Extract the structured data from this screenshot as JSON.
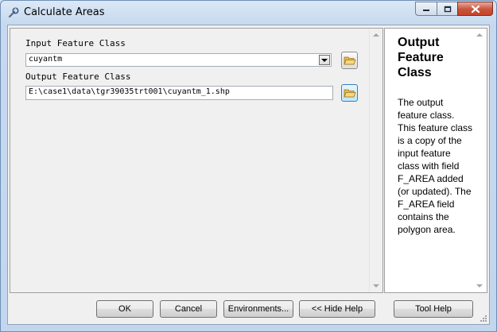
{
  "window": {
    "title": "Calculate Areas"
  },
  "form": {
    "input_label": "Input Feature Class",
    "input_value": "cuyantm",
    "output_label": "Output Feature Class",
    "output_value": "E:\\case1\\data\\tgr39035trt001\\cuyantm_1.shp"
  },
  "help": {
    "title": "Output Feature Class",
    "body": "The output feature class. This feature class is a copy of the input feature class with field F_AREA added (or updated). The F_AREA field contains the polygon area."
  },
  "buttons": {
    "ok": "OK",
    "cancel": "Cancel",
    "environments": "Environments...",
    "hide_help": "<< Hide Help",
    "tool_help": "Tool Help"
  },
  "icons": {
    "app": "toolbox-tool-icon",
    "browse": "open-folder-icon"
  },
  "colors": {
    "title_bar": "#dbe8f6",
    "close_button": "#c7533c",
    "help_background": "#ffffff"
  }
}
